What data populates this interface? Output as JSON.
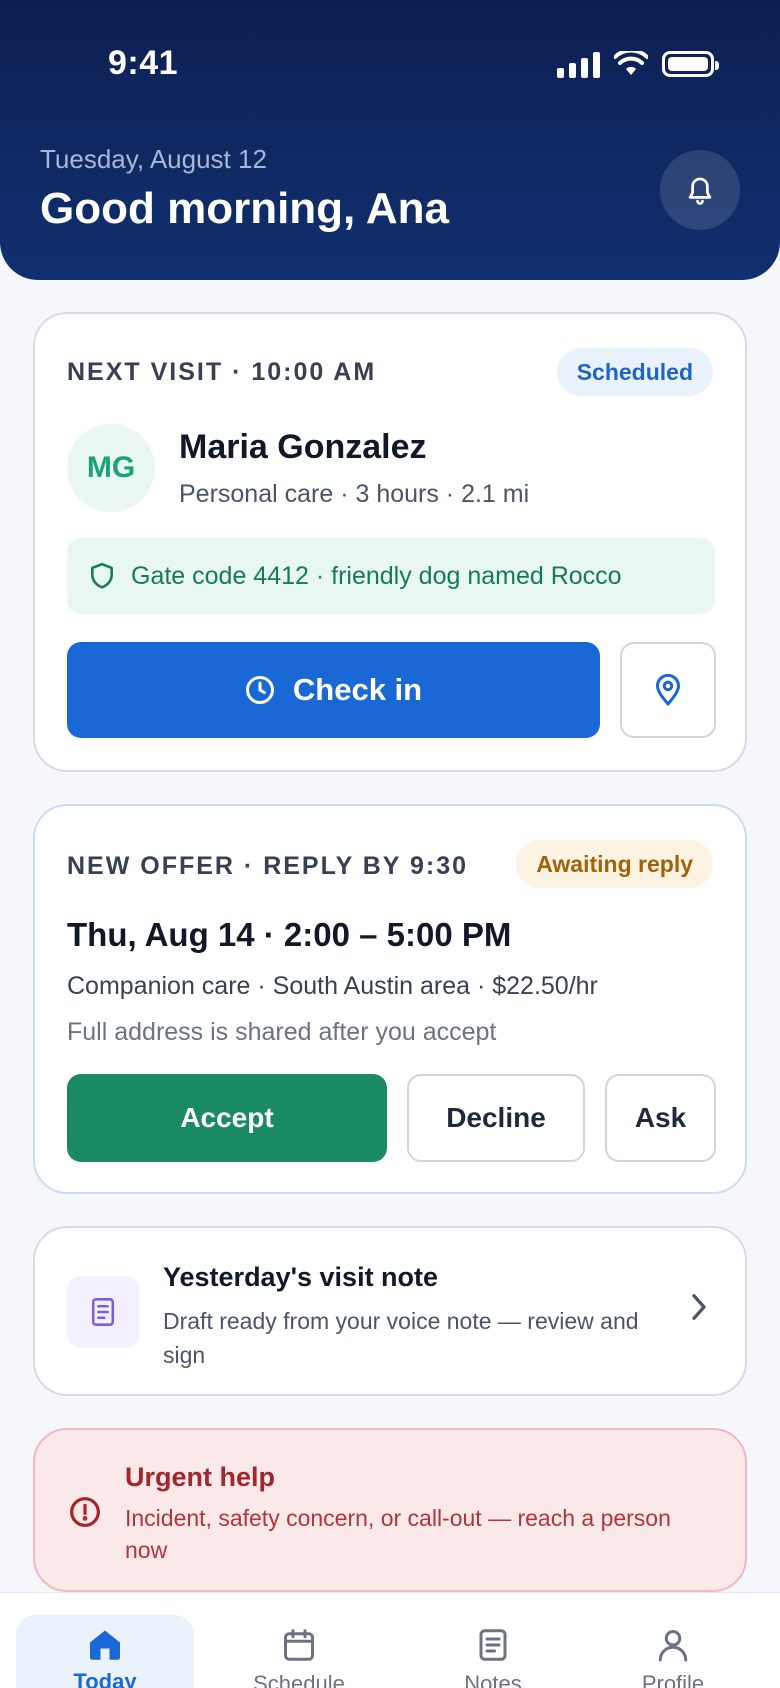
{
  "status_bar": {
    "time": "9:41"
  },
  "header": {
    "date": "Tuesday, August 12",
    "greeting": "Good morning, Ana"
  },
  "next_visit": {
    "eyebrow": "NEXT VISIT · 10:00 AM",
    "status": "Scheduled",
    "avatar_initials": "MG",
    "client_name": "Maria Gonzalez",
    "details": "Personal care · 3 hours · 2.1 mi",
    "access_note": "Gate code 4412 · friendly dog named Rocco",
    "checkin_label": "Check in"
  },
  "offer": {
    "eyebrow": "NEW OFFER · REPLY BY 9:30",
    "status": "Awaiting reply",
    "title": "Thu, Aug 14 · 2:00 – 5:00 PM",
    "details": "Companion care · South Austin area · $22.50/hr",
    "note": "Full address is shared after you accept",
    "accept_label": "Accept",
    "decline_label": "Decline",
    "ask_label": "Ask"
  },
  "visit_note": {
    "title": "Yesterday's visit note",
    "description": "Draft ready from your voice note — review and sign"
  },
  "urgent": {
    "title": "Urgent help",
    "description": "Incident, safety concern, or call-out — reach a person now"
  },
  "nav": {
    "items": [
      {
        "label": "Today",
        "icon": "home-icon",
        "active": true
      },
      {
        "label": "Schedule",
        "icon": "calendar-icon",
        "active": false
      },
      {
        "label": "Notes",
        "icon": "notes-icon",
        "active": false
      },
      {
        "label": "Profile",
        "icon": "profile-icon",
        "active": false
      }
    ]
  },
  "colors": {
    "header_bg": "#0d1f52",
    "primary": "#1a68d6",
    "success": "#198a64",
    "danger": "#a3262f"
  }
}
